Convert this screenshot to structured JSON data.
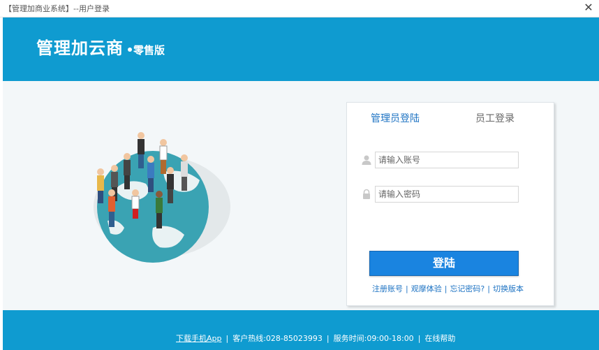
{
  "window": {
    "title": "【管理加商业系统】--用户登录"
  },
  "header": {
    "logo_main": "管理加云商",
    "logo_sub": "零售版"
  },
  "login": {
    "tab_admin": "管理员登陆",
    "tab_staff": "员工登录",
    "username_placeholder": "请输入账号",
    "password_placeholder": "请输入密码",
    "submit_label": "登陆",
    "links": [
      "注册账号",
      "观摩体验",
      "忘记密码?",
      "切换版本"
    ]
  },
  "footer": {
    "download_app": "下载手机App",
    "hotline": "客户热线:028-85023993",
    "service_hours": "服务时间:09:00-18:00",
    "online_help": "在线帮助"
  },
  "colors": {
    "brand": "#0f9bd0",
    "button": "#1a84e0",
    "link": "#1e73c3"
  }
}
